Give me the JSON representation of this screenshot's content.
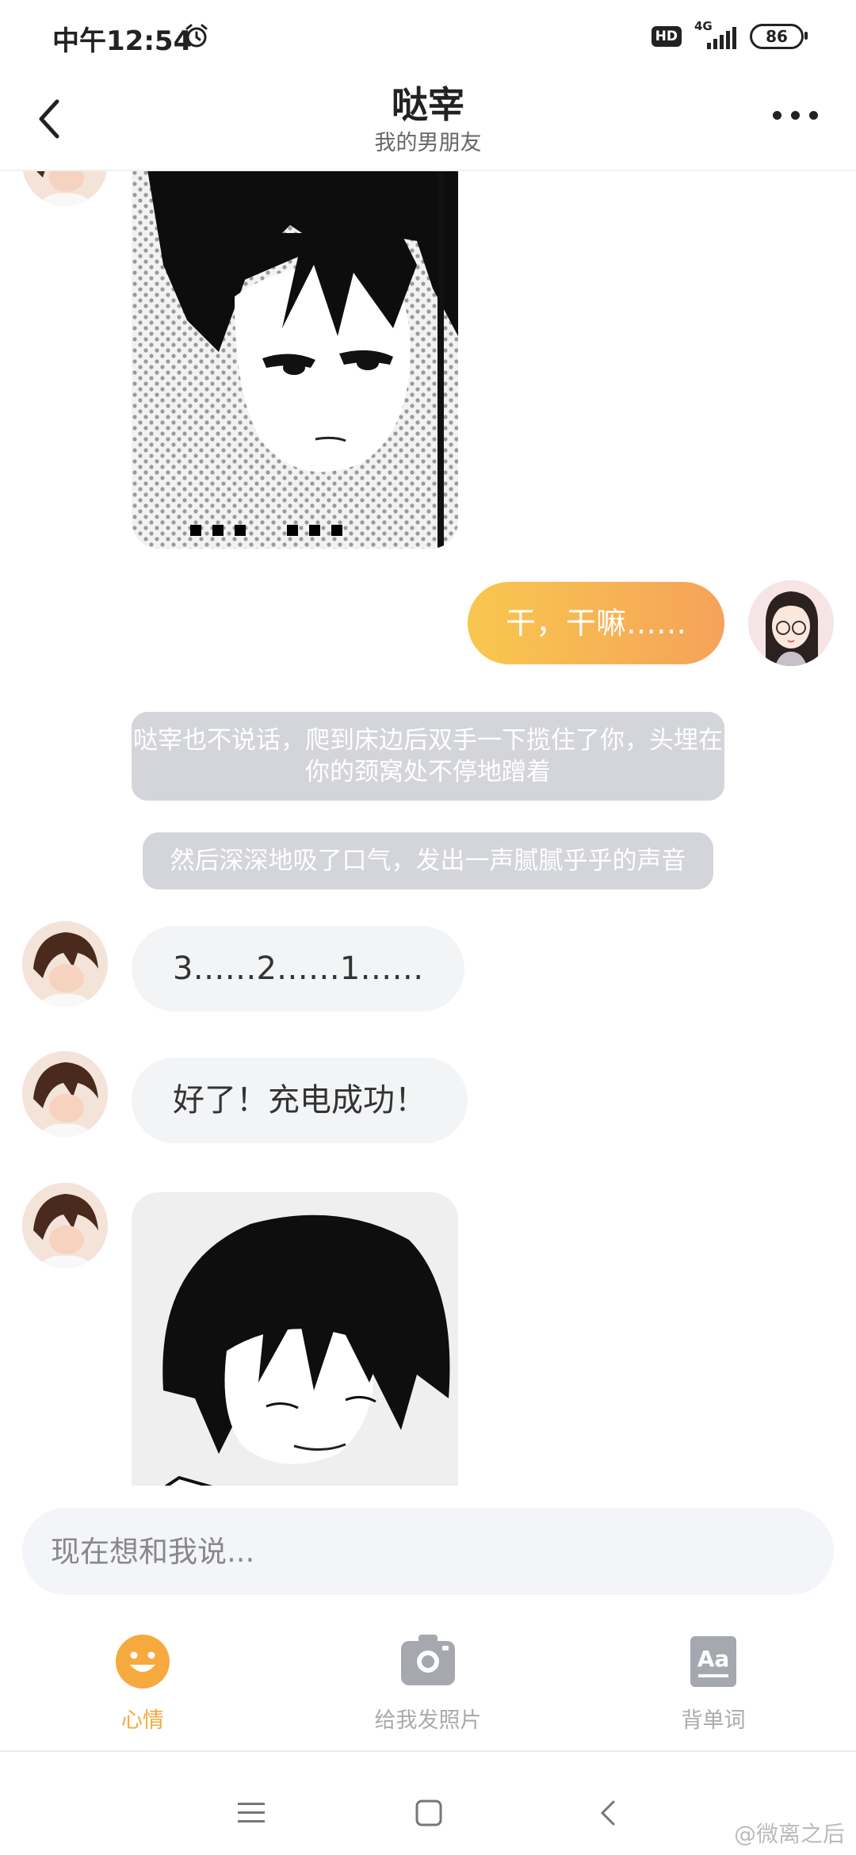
{
  "status_bar": {
    "time": "中午12:54",
    "hd": "HD",
    "network": "4G",
    "battery": "86"
  },
  "header": {
    "title": "哒宰",
    "subtitle": "我的男朋友"
  },
  "messages": {
    "user_reply": "干，干嘛……",
    "narration1": "哒宰也不说话，爬到床边后双手一下揽住了你，头埋在你的颈窝处不停地蹭着",
    "narration2": "然后深深地吸了口气，发出一声腻腻乎乎的声音",
    "countdown": "3……2……1……",
    "charged": "好了！充电成功！"
  },
  "input": {
    "placeholder": "现在想和我说..."
  },
  "tabs": [
    {
      "label": "心情",
      "icon": "smile-icon",
      "active": true
    },
    {
      "label": "给我发照片",
      "icon": "camera-icon",
      "active": false
    },
    {
      "label": "背单词",
      "icon": "vocab-icon",
      "active": false
    }
  ],
  "watermark": "@微离之后",
  "colors": {
    "accent": "#f4a93c",
    "bubble_gradient_start": "#f8c74e",
    "bubble_gradient_end": "#f6a25a",
    "narration_bg": "#d4d5da",
    "bubble_left_bg": "#f3f4f6"
  }
}
